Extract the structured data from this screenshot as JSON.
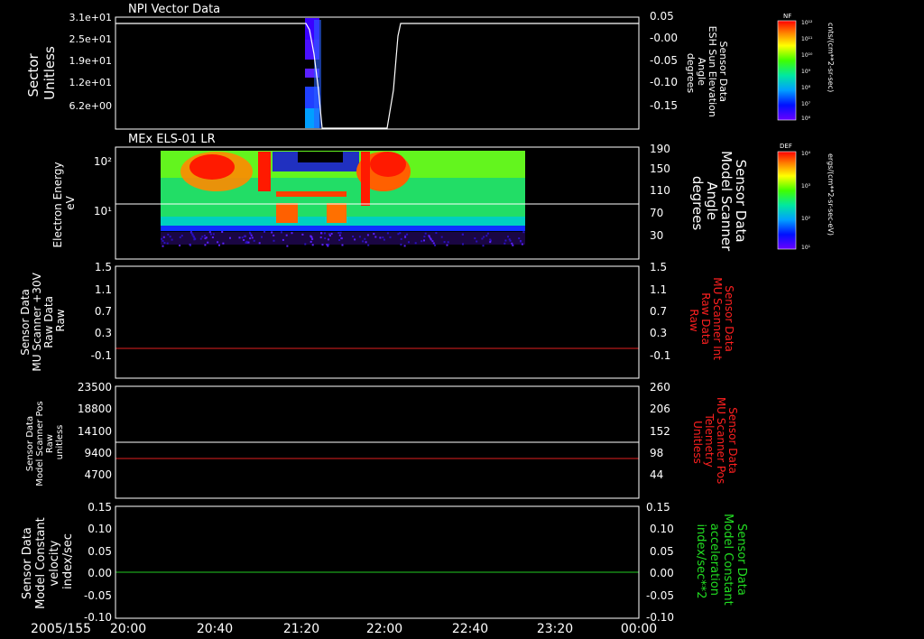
{
  "date_label": "2005/155",
  "x_ticks": [
    "20:00",
    "20:40",
    "21:20",
    "22:00",
    "22:40",
    "23:20",
    "00:00"
  ],
  "panels": [
    {
      "id": "npi",
      "title": "NPI Vector Data",
      "left_label": [
        "Sector",
        "Unitless"
      ],
      "left_ticks": [
        "3.1e+01",
        "2.5e+01",
        "1.9e+01",
        "1.2e+01",
        "6.2e+00"
      ],
      "right_label": [
        "Sensor Data",
        "ESH Sun Elevation",
        "Angle",
        "degrees"
      ],
      "right_ticks": [
        "0.05",
        "-0.00",
        "-0.05",
        "-0.10",
        "-0.15"
      ],
      "right_label_color": "#ffffff"
    },
    {
      "id": "els",
      "title": "MEx ELS-01 LR",
      "left_label": [
        "Electron Energy",
        "eV"
      ],
      "left_ticks": [
        "10²",
        "10¹"
      ],
      "right_label": [
        "Sensor Data",
        "Model Scanner",
        "Angle",
        "degrees"
      ],
      "right_ticks": [
        "190",
        "150",
        "110",
        "70",
        "30"
      ],
      "right_label_color": "#ffffff"
    },
    {
      "id": "mu_raw",
      "title": "",
      "left_label": [
        "Sensor Data",
        "MU Scanner +30V",
        "Raw Data",
        "Raw"
      ],
      "left_ticks": [
        "1.5",
        "1.1",
        "0.7",
        "0.3",
        "-0.1"
      ],
      "right_label": [
        "Sensor Data",
        "MU Scanner Int",
        "Raw Data",
        "Raw"
      ],
      "right_ticks": [
        "1.5",
        "1.1",
        "0.7",
        "0.3",
        "-0.1"
      ],
      "right_label_color": "#ff2020"
    },
    {
      "id": "scanner_pos",
      "title": "",
      "left_label": [
        "Sensor Data",
        "Model Scanner Pos",
        "Raw",
        "unitless"
      ],
      "left_ticks": [
        "23500",
        "18800",
        "14100",
        "9400",
        "4700"
      ],
      "right_label": [
        "Sensor Data",
        "MU Scanner Pos",
        "Telemetry",
        "Unitless"
      ],
      "right_ticks": [
        "260",
        "206",
        "152",
        "98",
        "44"
      ],
      "right_label_color": "#ff2020"
    },
    {
      "id": "velocity",
      "title": "",
      "left_label": [
        "Sensor Data",
        "Model Constant",
        "velocity",
        "index/sec"
      ],
      "left_ticks": [
        "0.15",
        "0.10",
        "0.05",
        "0.00",
        "-0.05",
        "-0.10"
      ],
      "right_label": [
        "Sensor Data",
        "Model Constant",
        "acceleration",
        "index/sec**2"
      ],
      "right_ticks": [
        "0.15",
        "0.10",
        "0.05",
        "0.00",
        "-0.05",
        "-0.10"
      ],
      "right_label_color": "#22dd22"
    }
  ],
  "colorbars": [
    {
      "id": "nf",
      "tag": "NF",
      "ticks": [
        "10¹²",
        "10¹¹",
        "10¹⁰",
        "10⁹",
        "10⁸",
        "10⁷",
        "10⁶"
      ],
      "unit": "cnts/(cm**2-sr-sec)"
    },
    {
      "id": "def",
      "tag": "DEF",
      "ticks": [
        "10⁴",
        "10³",
        "10²",
        "10¹"
      ],
      "unit": "ergs/(cm**2-sr-sec-eV)"
    }
  ],
  "colors": {
    "red_line": "#e02020",
    "green_line": "#22cc22",
    "white_line": "#ffffff"
  },
  "chart_data": [
    {
      "type": "heatmap",
      "panel": "npi",
      "ylabel": "Sector Unitless",
      "overlay": {
        "name": "ESH Sun Elevation Angle",
        "unit": "degrees",
        "x": [
          "20:00",
          "21:11",
          "21:14",
          "21:17",
          "21:21",
          "21:56",
          "22:02",
          "22:04",
          "00:00"
        ],
        "y": [
          0.05,
          0.05,
          0.02,
          -0.06,
          -0.25,
          -0.25,
          -0.05,
          0.05,
          0.05
        ]
      }
    },
    {
      "type": "heatmap",
      "panel": "els",
      "ylabel": "Electron Energy eV",
      "x_range": [
        "20:12",
        "22:55"
      ],
      "horizontal_line": {
        "value_deg": 80
      }
    },
    {
      "type": "line",
      "panel": "mu_raw",
      "series": [
        {
          "color": "red",
          "y": [
            0.0,
            0.0
          ]
        }
      ]
    },
    {
      "type": "line",
      "panel": "scanner_pos",
      "series": [
        {
          "color": "white",
          "y": [
            11600,
            11600
          ]
        },
        {
          "color": "red",
          "y": [
            8000,
            8000
          ]
        }
      ]
    },
    {
      "type": "line",
      "panel": "velocity",
      "series": [
        {
          "color": "green",
          "y": [
            0.0,
            0.0
          ]
        }
      ]
    }
  ]
}
